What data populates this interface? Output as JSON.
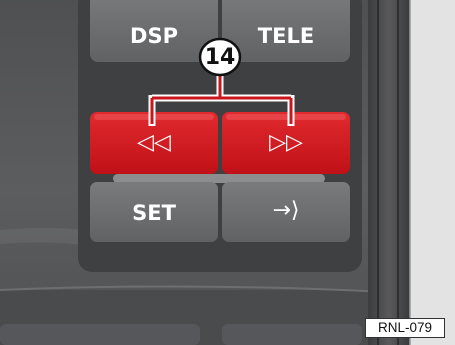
{
  "buttons": {
    "dsp_label": "DSP",
    "tele_label": "TELE",
    "rewind_icon": "◁◁",
    "forward_icon": "▷▷",
    "set_label": "SET",
    "exit_icon": "→⟩"
  },
  "callout": {
    "number": "14"
  },
  "figure": {
    "code": "RNL-079"
  },
  "colors": {
    "red_button": "#d4161e",
    "gray_button": "#6b6c6e",
    "panel": "#5a5a5c"
  },
  "icons": {
    "rewind": "rewind-icon",
    "forward": "fast-forward-icon",
    "exit": "exit-arrow-icon"
  }
}
